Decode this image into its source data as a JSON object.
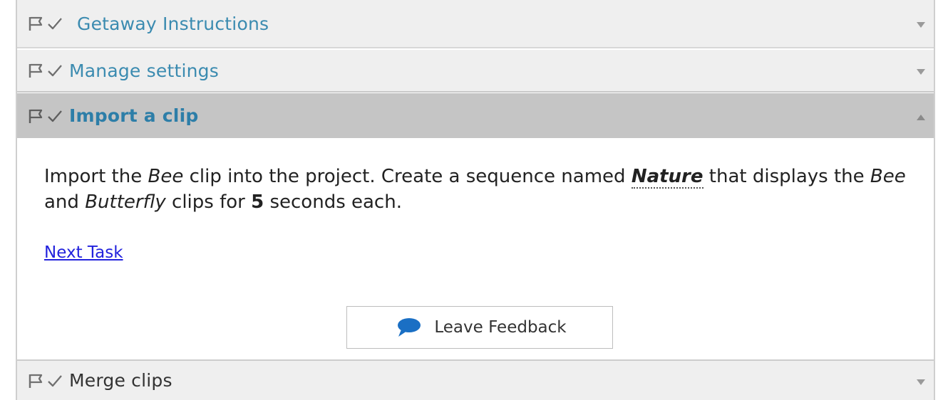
{
  "accordion": {
    "sections": [
      {
        "title": "Getaway Instructions",
        "expanded": false
      },
      {
        "title": "Manage settings",
        "expanded": false
      },
      {
        "title": "Import a clip",
        "expanded": true
      },
      {
        "title": "Merge clips",
        "expanded": false
      }
    ]
  },
  "task": {
    "text": {
      "p1": "Import the ",
      "bee": "Bee",
      "p2": " clip into the project. Create a sequence named ",
      "nature": "Nature",
      "p3": " that displays the ",
      "bee2": "Bee",
      "p4": " and ",
      "butterfly": "Butterfly",
      "p5": " clips for ",
      "seconds": "5",
      "p6": " seconds each."
    },
    "next_link": "Next Task",
    "feedback_button": "Leave Feedback"
  },
  "icons": {
    "flag": "flag-icon",
    "check": "check-icon",
    "chevron_down": "chevron-down-icon",
    "chevron_up": "chevron-up-icon",
    "speech_bubble": "speech-bubble-icon"
  },
  "colors": {
    "header_bg": "#efefef",
    "active_header_bg": "#c5c5c5",
    "title_link": "#3b8bb0",
    "link": "#2222dd",
    "bubble": "#1a6fc4"
  }
}
